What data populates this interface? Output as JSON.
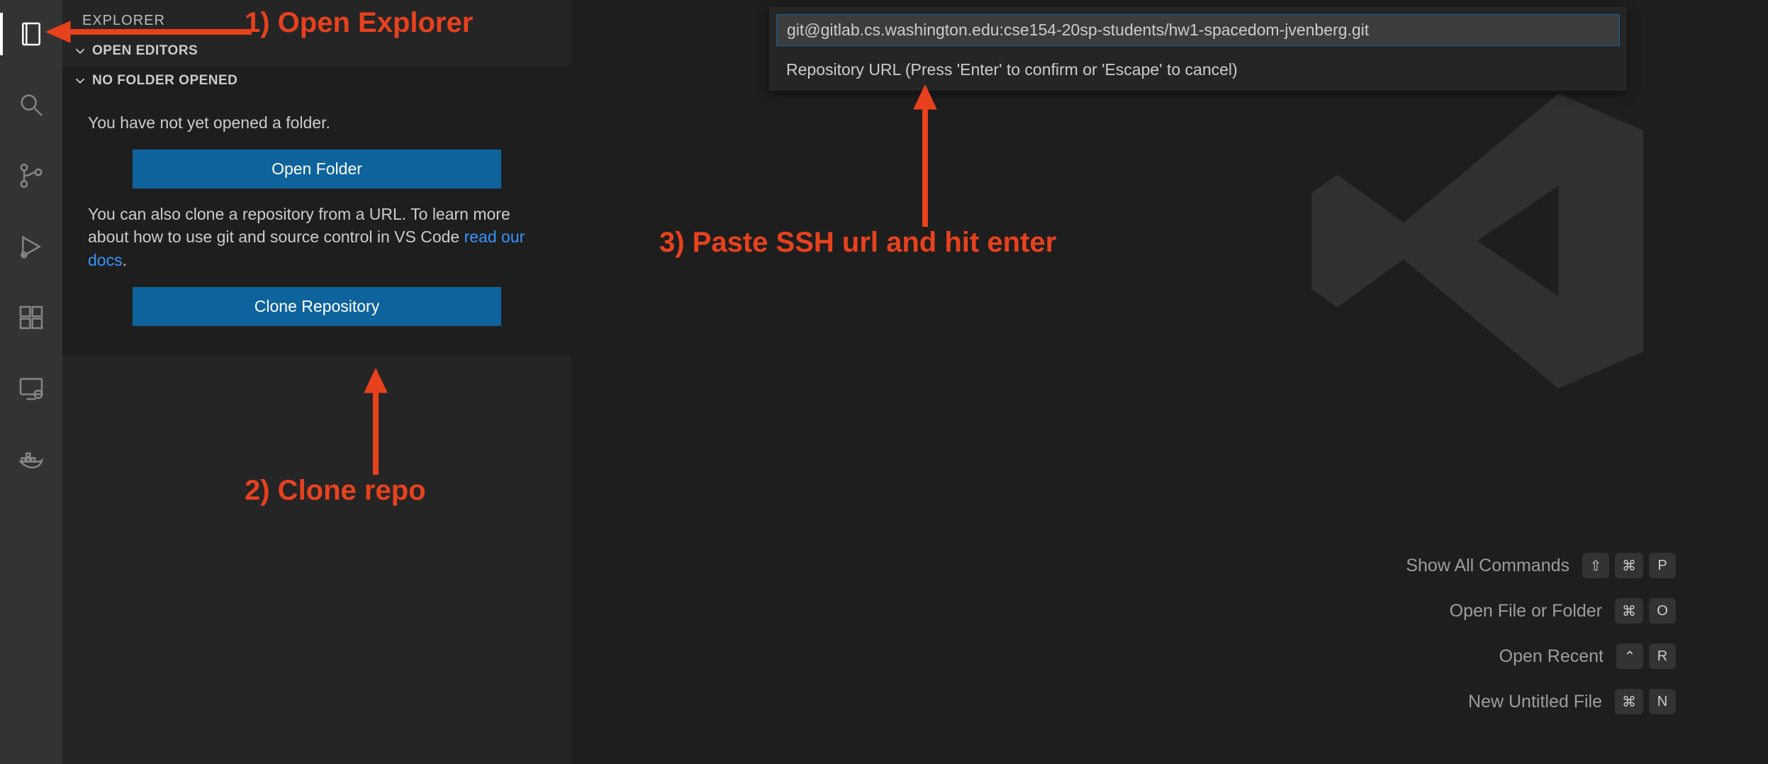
{
  "activity_bar": {
    "items": [
      {
        "name": "explorer",
        "label": "Explorer",
        "active": true
      },
      {
        "name": "search",
        "label": "Search",
        "active": false
      },
      {
        "name": "source-control",
        "label": "Source Control",
        "active": false
      },
      {
        "name": "run-debug",
        "label": "Run and Debug",
        "active": false
      },
      {
        "name": "extensions",
        "label": "Extensions",
        "active": false
      },
      {
        "name": "remote",
        "label": "Remote Explorer",
        "active": false
      },
      {
        "name": "docker",
        "label": "Docker",
        "active": false
      }
    ]
  },
  "sidebar": {
    "title": "EXPLORER",
    "sections": {
      "open_editors": "OPEN EDITORS",
      "no_folder": "NO FOLDER OPENED"
    },
    "body": {
      "no_folder_text": "You have not yet opened a folder.",
      "open_folder_button": "Open Folder",
      "clone_text_before": "You can also clone a repository from a URL. To learn more about how to use git and source control in VS Code ",
      "clone_link": "read our docs",
      "clone_text_after": ".",
      "clone_button": "Clone Repository"
    }
  },
  "quick_input": {
    "value": "git@gitlab.cs.washington.edu:cse154-20sp-students/hw1-spacedom-jvenberg.git",
    "description": "Repository URL (Press 'Enter' to confirm or 'Escape' to cancel)"
  },
  "hints": [
    {
      "label": "Show All Commands",
      "keys": [
        "⇧",
        "⌘",
        "P"
      ]
    },
    {
      "label": "Open File or Folder",
      "keys": [
        "⌘",
        "O"
      ]
    },
    {
      "label": "Open Recent",
      "keys": [
        "⌃",
        "R"
      ]
    },
    {
      "label": "New Untitled File",
      "keys": [
        "⌘",
        "N"
      ]
    }
  ],
  "annotations": {
    "a1": "1) Open Explorer",
    "a2": "2) Clone repo",
    "a3": "3) Paste SSH url and hit enter"
  }
}
